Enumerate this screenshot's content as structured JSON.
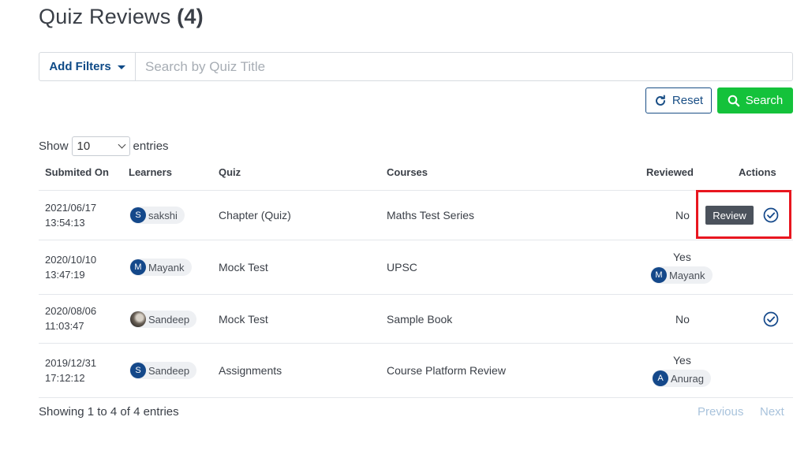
{
  "page": {
    "title": "Quiz Reviews",
    "count": "(4)"
  },
  "filters": {
    "add_filters_label": "Add Filters",
    "search_placeholder": "Search by Quiz Title",
    "reset_label": "Reset",
    "search_label": "Search"
  },
  "entries": {
    "show_label": "Show",
    "selected": "10",
    "entries_label": "entries"
  },
  "table": {
    "headers": {
      "submitted_on": "Submited On",
      "learners": "Learners",
      "quiz": "Quiz",
      "courses": "Courses",
      "reviewed": "Reviewed",
      "actions": "Actions"
    },
    "rows": [
      {
        "date": "2021/06/17",
        "time": "13:54:13",
        "learner": "sakshi",
        "learner_initial": "S",
        "quiz": "Chapter (Quiz)",
        "course": "Maths Test Series",
        "reviewed": "No",
        "action_label": "Review"
      },
      {
        "date": "2020/10/10",
        "time": "13:47:19",
        "learner": "Mayank",
        "learner_initial": "M",
        "quiz": "Mock Test",
        "course": "UPSC",
        "reviewed": "Yes",
        "reviewer": "Mayank",
        "reviewer_initial": "M"
      },
      {
        "date": "2020/08/06",
        "time": "11:03:47",
        "learner": "Sandeep",
        "quiz": "Mock Test",
        "course": "Sample Book",
        "reviewed": "No"
      },
      {
        "date": "2019/12/31",
        "time": "17:12:12",
        "learner": "Sandeep",
        "learner_initial": "S",
        "quiz": "Assignments",
        "course": "Course Platform Review",
        "reviewed": "Yes",
        "reviewer": "Anurag",
        "reviewer_initial": "A"
      }
    ]
  },
  "footer": {
    "info": "Showing 1 to 4 of 4 entries",
    "previous": "Previous",
    "next": "Next"
  },
  "colors": {
    "primary": "#14488a",
    "success": "#14c23b",
    "highlight": "#e8161f",
    "review_button": "#4b525c"
  },
  "icons": {
    "reset": "refresh-icon",
    "search": "search-icon",
    "action": "check-circle-icon"
  }
}
